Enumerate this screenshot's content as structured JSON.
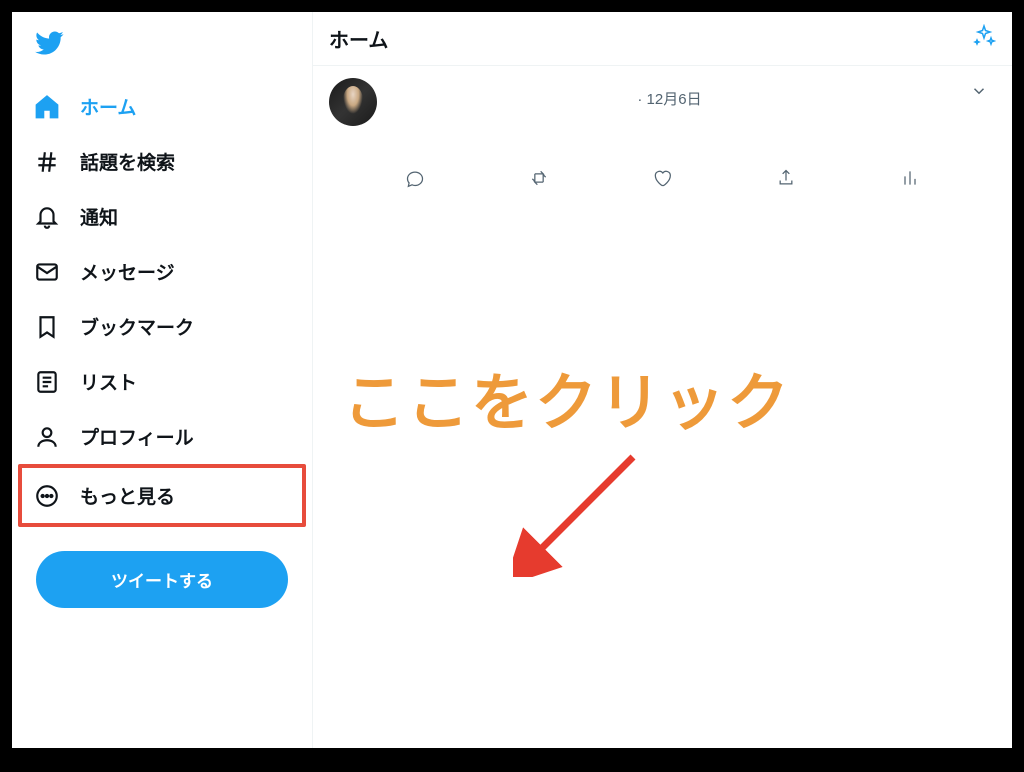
{
  "sidebar": {
    "items": [
      {
        "label": "ホーム",
        "name": "home"
      },
      {
        "label": "話題を検索",
        "name": "explore"
      },
      {
        "label": "通知",
        "name": "notifications"
      },
      {
        "label": "メッセージ",
        "name": "messages"
      },
      {
        "label": "ブックマーク",
        "name": "bookmarks"
      },
      {
        "label": "リスト",
        "name": "lists"
      },
      {
        "label": "プロフィール",
        "name": "profile"
      },
      {
        "label": "もっと見る",
        "name": "more"
      }
    ],
    "tweet_button": "ツイートする"
  },
  "header": {
    "title": "ホーム"
  },
  "tweet": {
    "date": "· 12月6日"
  },
  "annotation": {
    "text": "ここをクリック"
  },
  "colors": {
    "accent": "#1da1f2",
    "highlight_box": "#e74c3c",
    "annotation": "#ee9a3a"
  }
}
